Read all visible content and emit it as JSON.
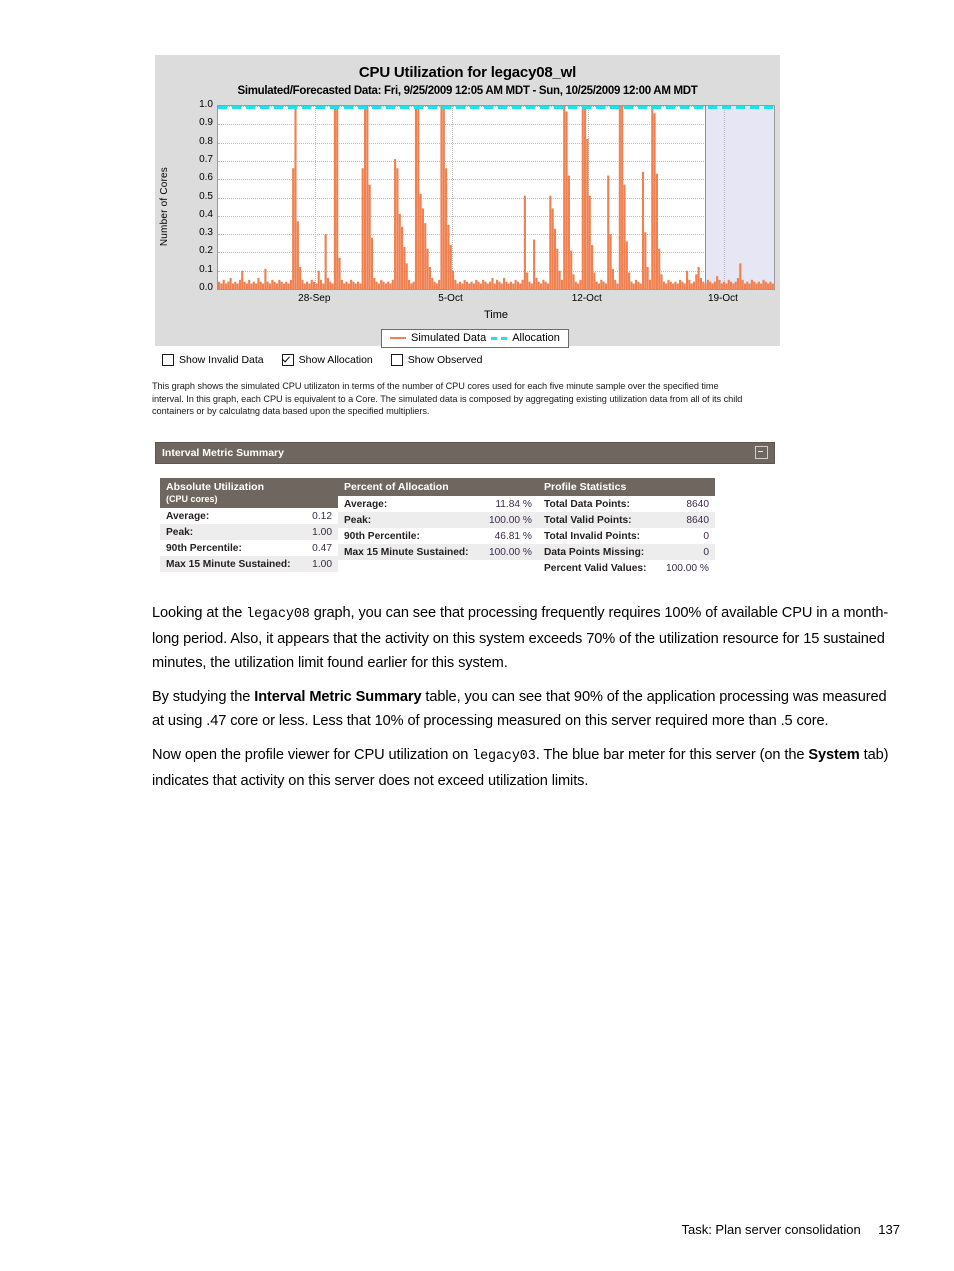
{
  "chart_panel": {
    "title": "CPU Utilization for legacy08_wl",
    "subtitle": "Simulated/Forecasted Data: Fri, 9/25/2009 12:05 AM MDT - Sun, 10/25/2009 12:00 AM MDT",
    "legend": {
      "simulated_label": "Simulated Data",
      "allocation_label": "Allocation"
    },
    "colors": {
      "simulated": "#f08050",
      "allocation": "#1ee0ef",
      "panel_bg": "#dcdcdc",
      "plot_bg": "#ffffff",
      "forecast_band": "#e6e6f5",
      "header_bar": "#6f675f"
    }
  },
  "chart_data": {
    "type": "area",
    "title": "CPU Utilization for legacy08_wl",
    "subtitle": "Simulated/Forecasted Data: Fri, 9/25/2009 12:05 AM MDT - Sun, 10/25/2009 12:00 AM MDT",
    "xlabel": "Time",
    "ylabel": "Number of Cores",
    "ylim": [
      0.0,
      1.0
    ],
    "yticks": [
      "0.0",
      "0.1",
      "0.2",
      "0.3",
      "0.4",
      "0.5",
      "0.6",
      "0.7",
      "0.8",
      "0.9",
      "1.0"
    ],
    "xticks": [
      "28-Sep",
      "5-Oct",
      "12-Oct",
      "19-Oct"
    ],
    "xtick_positions_pct": [
      17.5,
      42.0,
      66.5,
      91.0
    ],
    "grid": true,
    "legend_position": "bottom-center",
    "annotations": [
      {
        "name": "forecast-region",
        "start_pct": 87.5,
        "end_pct": 100.0,
        "color": "#e6e6f5"
      }
    ],
    "series": [
      {
        "name": "Allocation",
        "style": "dashed",
        "color": "#1ee0ef",
        "constant_value": 1.0
      },
      {
        "name": "Simulated Data",
        "style": "filled-spikes",
        "color": "#f08050",
        "baseline": 0.03,
        "values": [
          0.04,
          0.03,
          0.05,
          0.03,
          0.04,
          0.06,
          0.03,
          0.04,
          0.03,
          0.05,
          0.1,
          0.04,
          0.03,
          0.05,
          0.03,
          0.04,
          0.03,
          0.06,
          0.04,
          0.03,
          0.11,
          0.04,
          0.03,
          0.05,
          0.04,
          0.03,
          0.05,
          0.04,
          0.03,
          0.04,
          0.03,
          0.05,
          0.66,
          1.0,
          0.37,
          0.12,
          0.05,
          0.03,
          0.04,
          0.03,
          0.05,
          0.04,
          0.03,
          0.1,
          0.05,
          0.03,
          0.3,
          0.06,
          0.04,
          0.03,
          1.0,
          1.0,
          0.17,
          0.05,
          0.03,
          0.04,
          0.03,
          0.05,
          0.04,
          0.03,
          0.04,
          0.03,
          0.66,
          1.0,
          1.0,
          0.57,
          0.28,
          0.06,
          0.04,
          0.03,
          0.05,
          0.04,
          0.03,
          0.04,
          0.03,
          0.05,
          0.71,
          0.66,
          0.41,
          0.34,
          0.23,
          0.14,
          0.05,
          0.03,
          0.04,
          1.0,
          1.0,
          0.52,
          0.44,
          0.36,
          0.22,
          0.12,
          0.06,
          0.04,
          0.03,
          0.05,
          1.0,
          1.0,
          0.66,
          0.35,
          0.24,
          0.1,
          0.05,
          0.03,
          0.04,
          0.03,
          0.05,
          0.04,
          0.03,
          0.04,
          0.03,
          0.05,
          0.04,
          0.03,
          0.05,
          0.04,
          0.03,
          0.04,
          0.06,
          0.03,
          0.05,
          0.04,
          0.03,
          0.06,
          0.04,
          0.03,
          0.04,
          0.03,
          0.05,
          0.04,
          0.03,
          0.05,
          0.51,
          0.09,
          0.04,
          0.03,
          0.27,
          0.06,
          0.04,
          0.03,
          0.05,
          0.04,
          0.03,
          0.51,
          0.44,
          0.33,
          0.22,
          0.1,
          0.05,
          1.0,
          0.97,
          0.62,
          0.21,
          0.08,
          0.04,
          0.03,
          0.05,
          1.0,
          1.0,
          0.82,
          0.51,
          0.24,
          0.09,
          0.04,
          0.03,
          0.05,
          0.04,
          0.03,
          0.62,
          0.3,
          0.11,
          0.05,
          0.03,
          1.0,
          1.0,
          0.57,
          0.26,
          0.09,
          0.04,
          0.03,
          0.05,
          0.04,
          0.03,
          0.64,
          0.31,
          0.12,
          0.05,
          1.0,
          0.96,
          0.63,
          0.22,
          0.08,
          0.04,
          0.03,
          0.05,
          0.04,
          0.03,
          0.04,
          0.03,
          0.05,
          0.04,
          0.03,
          0.1,
          0.05,
          0.03,
          0.04,
          0.08,
          0.12,
          0.06,
          0.04,
          0.03,
          0.05,
          0.04,
          0.03,
          0.04,
          0.07,
          0.05,
          0.03,
          0.04,
          0.03,
          0.05,
          0.04,
          0.03,
          0.04,
          0.06,
          0.14,
          0.05,
          0.03,
          0.04,
          0.03,
          0.05,
          0.04,
          0.03,
          0.04,
          0.03,
          0.05,
          0.04,
          0.03,
          0.04,
          0.03
        ]
      }
    ]
  },
  "checkboxes": [
    {
      "label": "Show Invalid Data",
      "checked": false
    },
    {
      "label": "Show Allocation",
      "checked": true
    },
    {
      "label": "Show Observed",
      "checked": false
    }
  ],
  "description": "This graph shows the simulated CPU utilizaton in terms of the number of CPU cores used for each five minute sample over the specified time interval. In this graph, each CPU is equivalent to a Core. The simulated data is composed by aggregating existing utilization data from all of its child containers or by calculatng data based upon the specified multipliers.",
  "interval_metric_summary": {
    "panel_title": "Interval Metric Summary",
    "collapse_icon": "minimize-icon",
    "columns": [
      {
        "header": "Absolute Utilization",
        "subheader": "(CPU cores)",
        "rows": [
          {
            "label": "Average:",
            "value": "0.12"
          },
          {
            "label": "Peak:",
            "value": "1.00"
          },
          {
            "label": "90th Percentile:",
            "value": "0.47"
          },
          {
            "label": "Max 15 Minute Sustained:",
            "value": "1.00"
          }
        ]
      },
      {
        "header": "Percent of Allocation",
        "subheader": "",
        "rows": [
          {
            "label": "Average:",
            "value": "11.84 %"
          },
          {
            "label": "Peak:",
            "value": "100.00 %"
          },
          {
            "label": "90th Percentile:",
            "value": "46.81 %"
          },
          {
            "label": "Max 15 Minute Sustained:",
            "value": "100.00 %"
          }
        ]
      },
      {
        "header": "Profile Statistics",
        "subheader": "",
        "rows": [
          {
            "label": "Total Data Points:",
            "value": "8640"
          },
          {
            "label": "Total Valid Points:",
            "value": "8640"
          },
          {
            "label": "Total Invalid Points:",
            "value": "0"
          },
          {
            "label": "Data Points Missing:",
            "value": "0"
          },
          {
            "label": "Percent Valid Values:",
            "value": "100.00 %"
          }
        ]
      }
    ]
  },
  "prose": {
    "p1_a": "Looking at the ",
    "p1_mono": "legacy08",
    "p1_b": " graph, you can see that processing frequently requires 100% of available CPU in a month-long period. Also, it appears that the activity on this system exceeds 70% of the utilization resource for 15 sustained minutes, the utilization limit found earlier for this system.",
    "p2_a": "By studying the ",
    "p2_bold": "Interval Metric Summary",
    "p2_b": " table, you can see that 90% of the application processing was measured at using .47 core or less. Less that 10% of processing measured on this server required more than .5 core.",
    "p3_a": "Now open the profile viewer for CPU utilization on ",
    "p3_mono": "legacy03",
    "p3_b": ". The blue bar meter for this server (on the ",
    "p3_bold": "System",
    "p3_c": " tab) indicates that activity on this server does not exceed utilization limits."
  },
  "footer": {
    "task": "Task: Plan server consolidation",
    "page_number": "137"
  }
}
